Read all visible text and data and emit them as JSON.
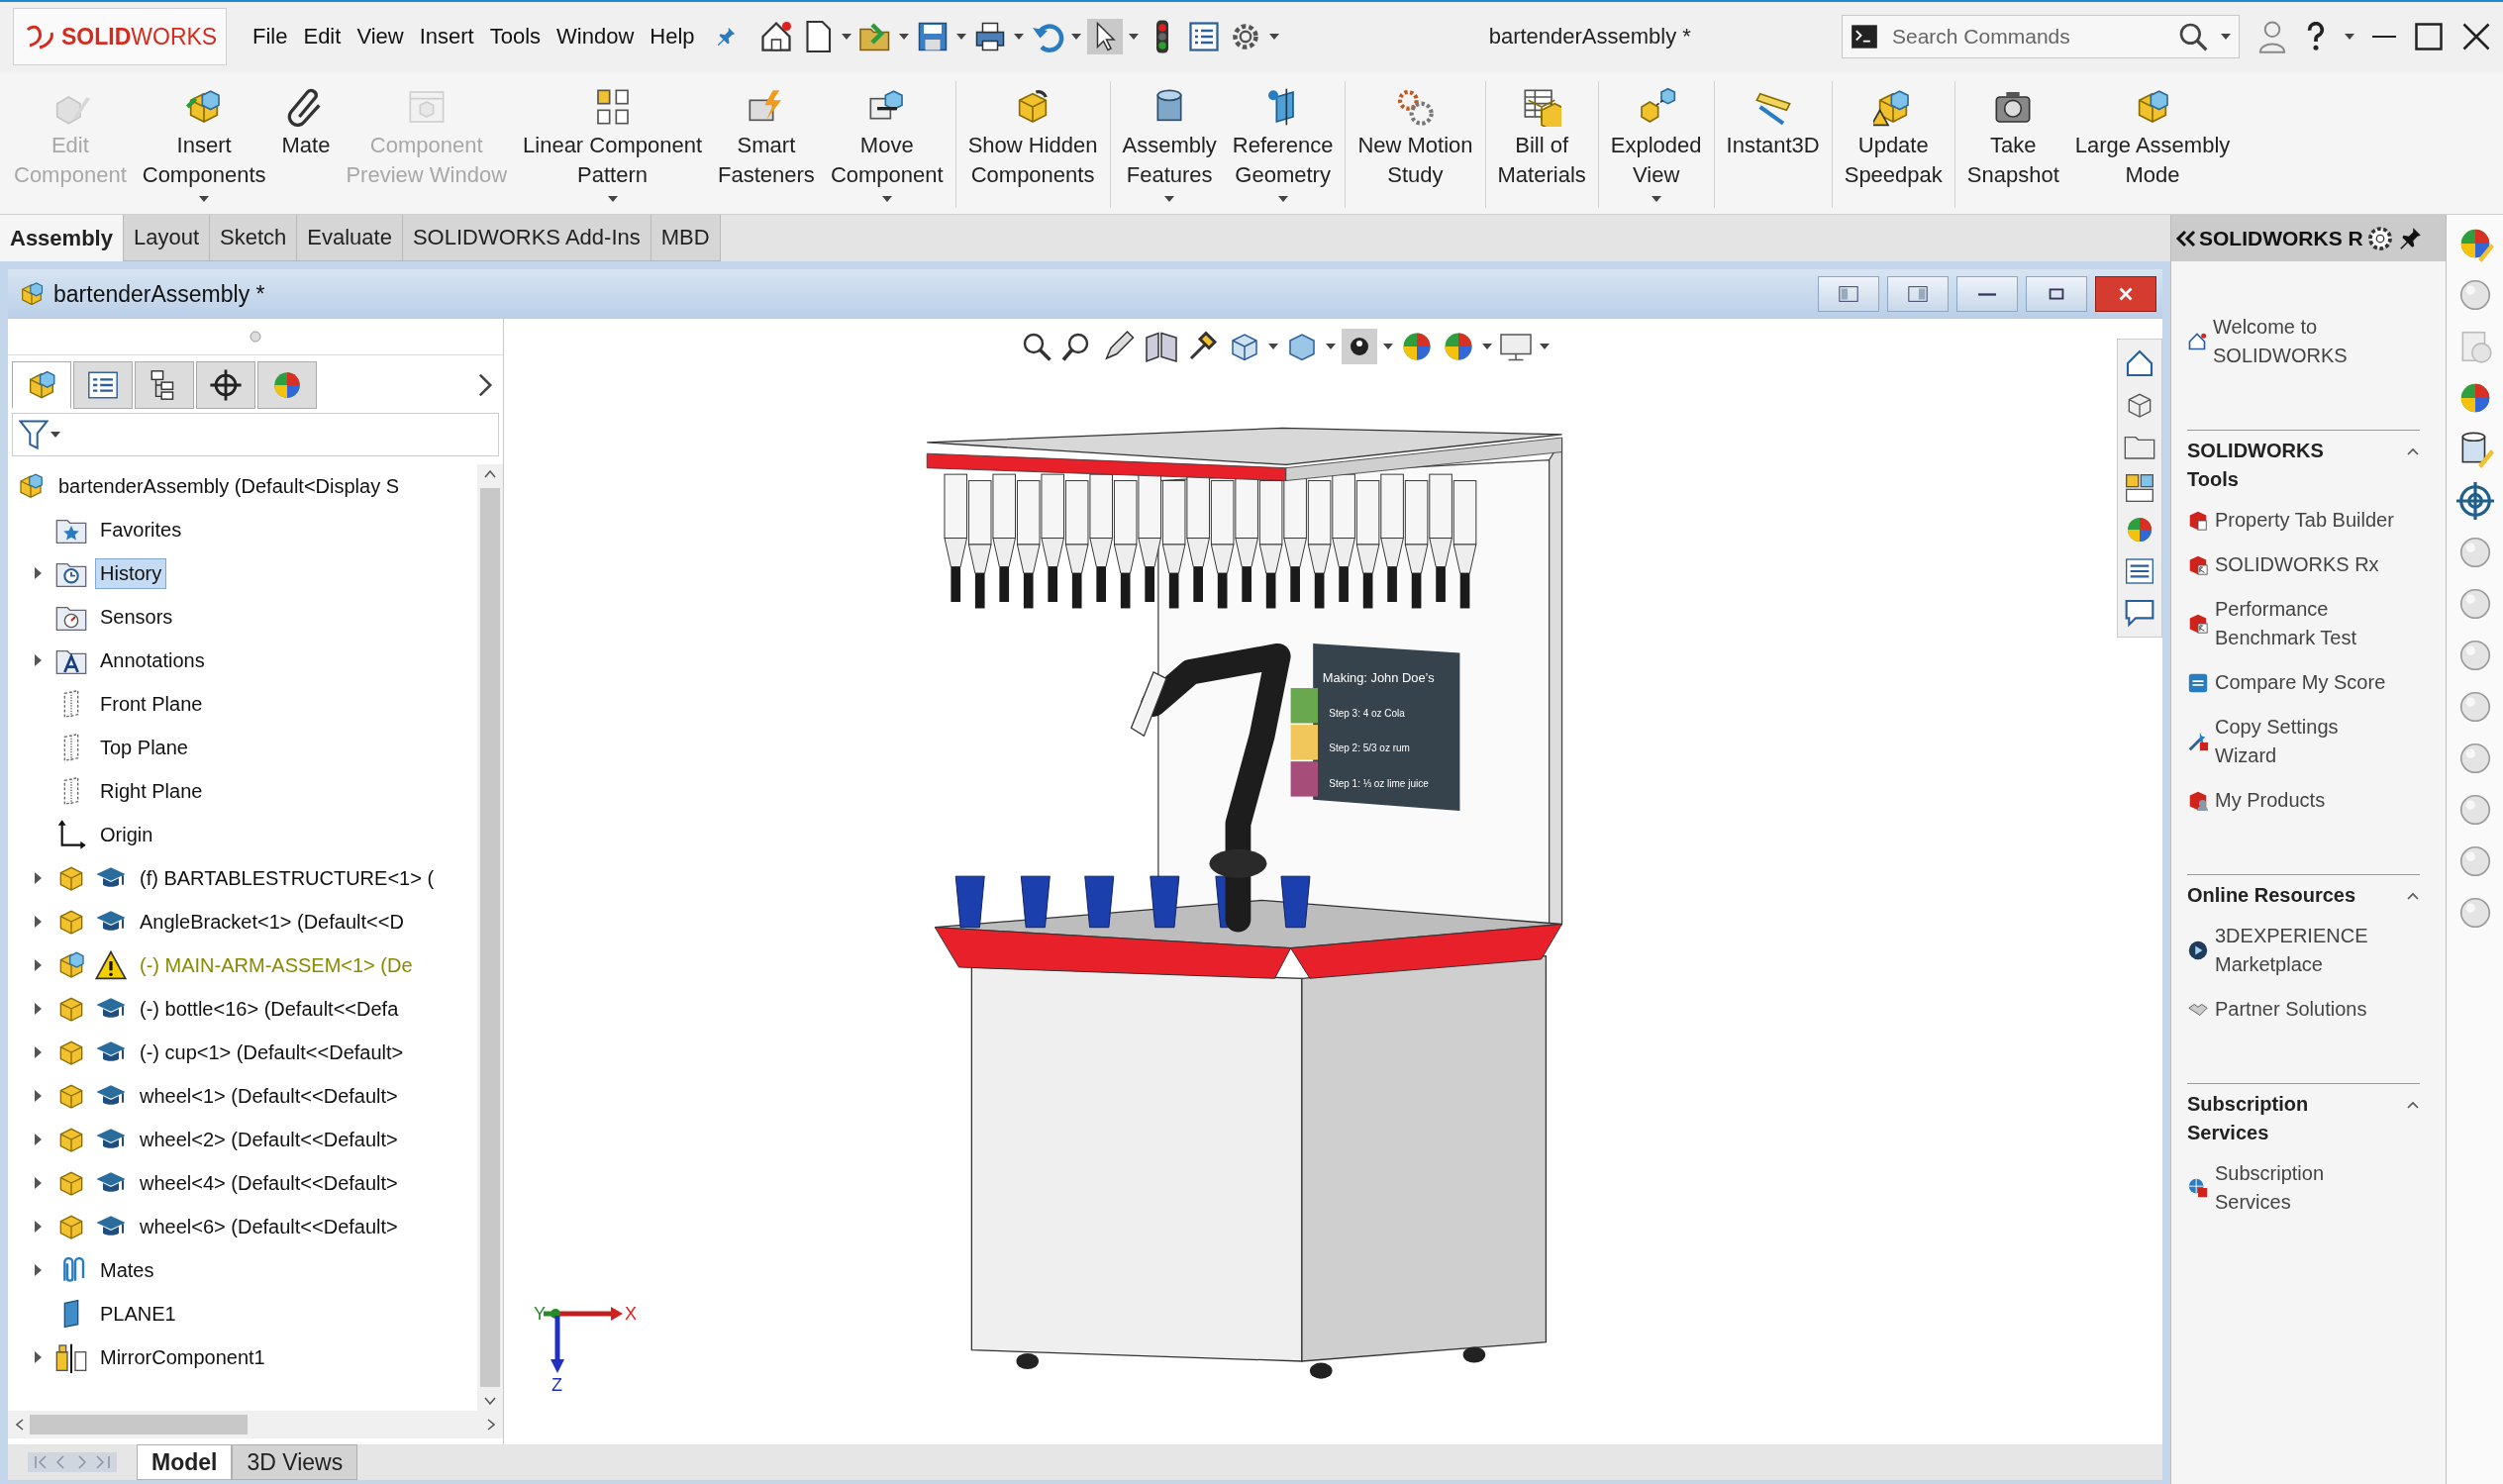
{
  "app": {
    "logo": "**SOLID**WORKS",
    "menu": [
      "File",
      "Edit",
      "View",
      "Insert",
      "Tools",
      "Window",
      "Help"
    ],
    "title": "bartenderAssembly *",
    "search": {
      "placeholder": "Search Commands"
    }
  },
  "ribbon": {
    "groups": [
      {
        "items": [
          {
            "label": "Edit\nComponent",
            "kind": "edit",
            "disabled": true,
            "dropdown": false
          },
          {
            "label": "Insert\nComponents",
            "kind": "insert",
            "disabled": false,
            "dropdown": true
          },
          {
            "label": "Mate",
            "kind": "mate",
            "disabled": false,
            "dropdown": false
          },
          {
            "label": "Component\nPreview Window",
            "kind": "preview",
            "disabled": true,
            "dropdown": false
          },
          {
            "label": "Linear Component\nPattern",
            "kind": "pattern",
            "disabled": false,
            "dropdown": true
          },
          {
            "label": "Smart\nFasteners",
            "kind": "fasteners",
            "disabled": false,
            "dropdown": false
          },
          {
            "label": "Move\nComponent",
            "kind": "move",
            "disabled": false,
            "dropdown": true
          }
        ]
      },
      {
        "items": [
          {
            "label": "Show Hidden\nComponents",
            "kind": "show",
            "disabled": false,
            "dropdown": false
          }
        ]
      },
      {
        "items": [
          {
            "label": "Assembly\nFeatures",
            "kind": "features",
            "disabled": false,
            "dropdown": true
          },
          {
            "label": "Reference\nGeometry",
            "kind": "reference",
            "disabled": false,
            "dropdown": true
          }
        ]
      },
      {
        "items": [
          {
            "label": "New Motion\nStudy",
            "kind": "motion",
            "disabled": false,
            "dropdown": false
          }
        ]
      },
      {
        "items": [
          {
            "label": "Bill of\nMaterials",
            "kind": "bom",
            "disabled": false,
            "dropdown": false
          }
        ]
      },
      {
        "items": [
          {
            "label": "Exploded\nView",
            "kind": "explode",
            "disabled": false,
            "dropdown": true
          }
        ]
      },
      {
        "items": [
          {
            "label": "Instant3D",
            "kind": "instant3d",
            "disabled": false,
            "dropdown": false
          }
        ]
      },
      {
        "items": [
          {
            "label": "Update\nSpeedpak",
            "kind": "speedpak",
            "disabled": false,
            "dropdown": false
          }
        ]
      },
      {
        "items": [
          {
            "label": "Take\nSnapshot",
            "kind": "snapshot",
            "disabled": false,
            "dropdown": false
          },
          {
            "label": "Large Assembly\nMode",
            "kind": "large",
            "disabled": false,
            "dropdown": false
          }
        ]
      }
    ]
  },
  "command_tabs": [
    {
      "label": "Assembly",
      "selected": true
    },
    {
      "label": "Layout",
      "selected": false
    },
    {
      "label": "Sketch",
      "selected": false
    },
    {
      "label": "Evaluate",
      "selected": false
    },
    {
      "label": "SOLIDWORKS Add-Ins",
      "selected": false
    },
    {
      "label": "MBD",
      "selected": false
    }
  ],
  "document": {
    "title": "bartenderAssembly *",
    "panel_tabs": [
      {
        "kind": "features",
        "selected": true
      },
      {
        "kind": "properties",
        "selected": false
      },
      {
        "kind": "configurations",
        "selected": false
      },
      {
        "kind": "dimxpert",
        "selected": false
      },
      {
        "kind": "display",
        "selected": false
      }
    ],
    "tree": {
      "text": "bartenderAssembly  (Default<Display S",
      "kind": "assembly",
      "children": [
        {
          "text": "Favorites",
          "kind": "favorites",
          "has_children": false,
          "selected": false,
          "warning": false
        },
        {
          "text": "History",
          "kind": "history",
          "has_children": true,
          "selected": true,
          "warning": false
        },
        {
          "text": "Sensors",
          "kind": "sensors",
          "has_children": false,
          "selected": false,
          "warning": false
        },
        {
          "text": "Annotations",
          "kind": "annotations",
          "has_children": true,
          "selected": false,
          "warning": false
        },
        {
          "text": "Front Plane",
          "kind": "plane",
          "has_children": false,
          "selected": false,
          "warning": false
        },
        {
          "text": "Top Plane",
          "kind": "plane",
          "has_children": false,
          "selected": false,
          "warning": false
        },
        {
          "text": "Right Plane",
          "kind": "plane",
          "has_children": false,
          "selected": false,
          "warning": false
        },
        {
          "text": "Origin",
          "kind": "origin",
          "has_children": false,
          "selected": false,
          "warning": false
        },
        {
          "text": "(f) BARTABLESTRUCTURE<1> (",
          "kind": "component",
          "has_children": true,
          "selected": false,
          "warning": false
        },
        {
          "text": "AngleBracket<1> (Default<<D",
          "kind": "component",
          "has_children": true,
          "selected": false,
          "warning": false
        },
        {
          "text": "(-) MAIN-ARM-ASSEM<1> (De",
          "kind": "subassembly",
          "has_children": true,
          "selected": false,
          "warning": true
        },
        {
          "text": "(-) bottle<16> (Default<<Defa",
          "kind": "component",
          "has_children": true,
          "selected": false,
          "warning": false
        },
        {
          "text": "(-) cup<1> (Default<<Default>",
          "kind": "component",
          "has_children": true,
          "selected": false,
          "warning": false
        },
        {
          "text": "wheel<1> (Default<<Default>",
          "kind": "component",
          "has_children": true,
          "selected": false,
          "warning": false
        },
        {
          "text": "wheel<2> (Default<<Default>",
          "kind": "component",
          "has_children": true,
          "selected": false,
          "warning": false
        },
        {
          "text": "wheel<4> (Default<<Default>",
          "kind": "component",
          "has_children": true,
          "selected": false,
          "warning": false
        },
        {
          "text": "wheel<6> (Default<<Default>",
          "kind": "component",
          "has_children": true,
          "selected": false,
          "warning": false
        },
        {
          "text": "Mates",
          "kind": "mates",
          "has_children": true,
          "selected": false,
          "warning": false
        },
        {
          "text": "PLANE1",
          "kind": "solid-plane",
          "has_children": false,
          "selected": false,
          "warning": false
        },
        {
          "text": "MirrorComponent1",
          "kind": "mirror",
          "has_children": true,
          "selected": false,
          "warning": false
        }
      ]
    },
    "bottom_tabs": [
      {
        "label": "Model",
        "selected": true
      },
      {
        "label": "3D Views",
        "selected": false
      }
    ],
    "viewport": {
      "sign": {
        "title": "Making: John Doe’s",
        "steps": [
          {
            "text": "Step 3: 4 oz Cola",
            "color": "#6aa84f"
          },
          {
            "text": "Step 2: 5/3 oz rum",
            "color": "#f1c75b"
          },
          {
            "text": "Step 1: ⅓ oz lime juice",
            "color": "#a64d79"
          }
        ]
      },
      "axes": {
        "x": "X",
        "y": "Y",
        "z": "Z"
      }
    }
  },
  "task_pane": {
    "title": "SOLIDWORKS R",
    "welcome": "Welcome to\nSOLIDWORKS",
    "sections": [
      {
        "title": "SOLIDWORKS\nTools",
        "expanded": true,
        "items": [
          {
            "text": "Property Tab Builder",
            "kind": "sw"
          },
          {
            "text": "SOLIDWORKS Rx",
            "kind": "rx"
          },
          {
            "text": "Performance\nBenchmark Test",
            "kind": "rx"
          },
          {
            "text": "Compare My Score",
            "kind": "score"
          },
          {
            "text": "Copy Settings\nWizard",
            "kind": "wizard"
          },
          {
            "text": "My Products",
            "kind": "products"
          }
        ]
      },
      {
        "title": "Online Resources",
        "expanded": true,
        "items": [
          {
            "text": "3DEXPERIENCE\nMarketplace",
            "kind": "marketplace"
          },
          {
            "text": "Partner Solutions",
            "kind": "partner"
          }
        ]
      },
      {
        "title": "Subscription\nServices",
        "expanded": true,
        "items": [
          {
            "text": "Subscription\nServices",
            "kind": "subscription"
          }
        ]
      }
    ]
  }
}
